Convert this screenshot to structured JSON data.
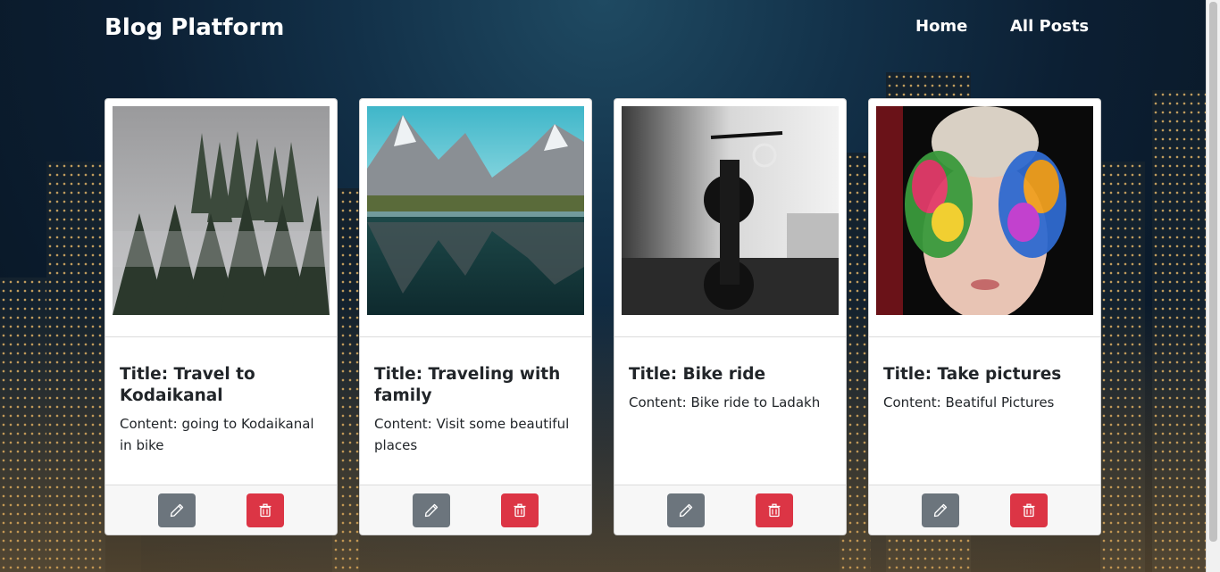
{
  "navbar": {
    "brand": "Blog Platform",
    "links": [
      {
        "label": "Home"
      },
      {
        "label": "All Posts"
      }
    ]
  },
  "colors": {
    "edit_button": "#6c757d",
    "delete_button": "#dc3545",
    "card_background": "#ffffff"
  },
  "icons": {
    "edit": "pencil-icon",
    "delete": "trash-icon"
  },
  "posts": [
    {
      "title": "Title: Travel to Kodaikanal",
      "content": "Content: going to Kodaikanal in bike",
      "image": "misty-forest"
    },
    {
      "title": "Title: Traveling with family",
      "content": "Content: Visit some beautiful places",
      "image": "mountain-lake"
    },
    {
      "title": "Title: Bike ride",
      "content": "Content: Bike ride to Ladakh",
      "image": "motorcycle"
    },
    {
      "title": "Title: Take pictures",
      "content": "Content: Beatiful Pictures",
      "image": "painted-hands"
    }
  ]
}
